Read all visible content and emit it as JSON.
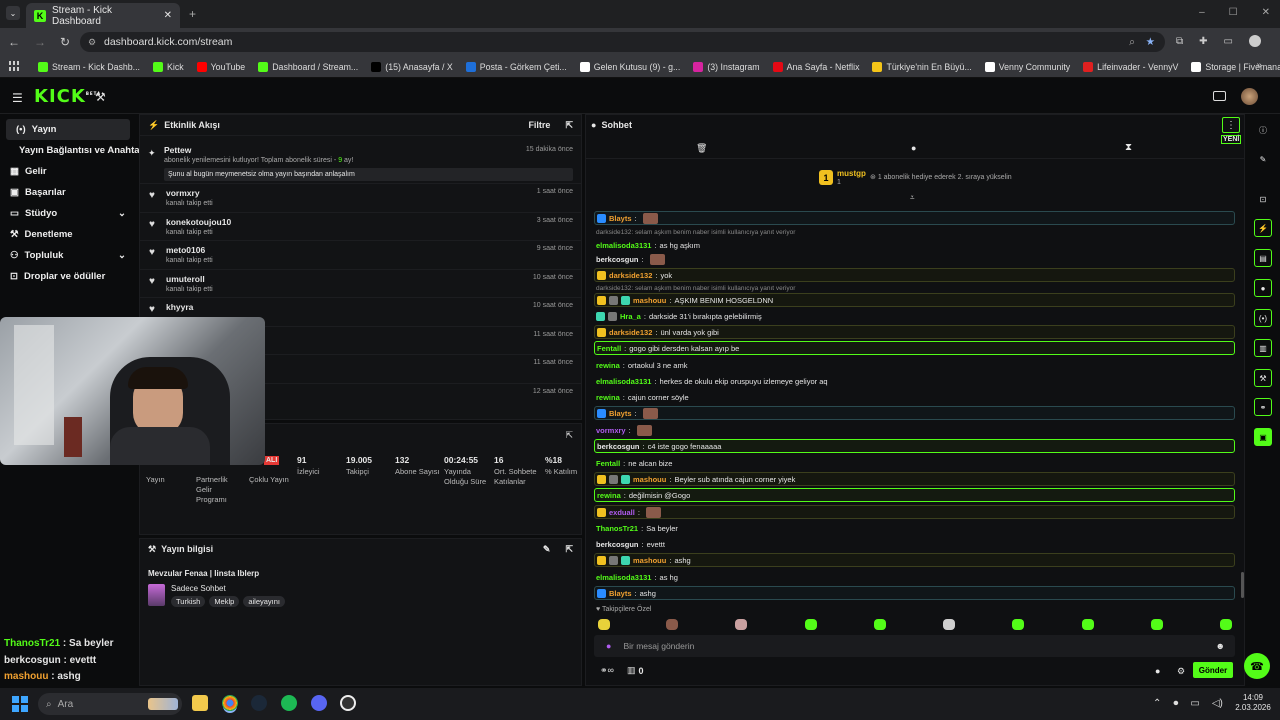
{
  "browser": {
    "tab_title": "Stream - Kick Dashboard",
    "url": "dashboard.kick.com/stream",
    "bookmarks": [
      {
        "label": "Stream - Kick Dashb...",
        "color": "#53fc18"
      },
      {
        "label": "Kick",
        "color": "#53fc18"
      },
      {
        "label": "YouTube",
        "color": "#ff0000"
      },
      {
        "label": "Dashboard / Stream...",
        "color": "#53fc18"
      },
      {
        "label": "(15) Anasayfa / X",
        "color": "#000000"
      },
      {
        "label": "Posta - Görkem Çeti...",
        "color": "#1e6fd9"
      },
      {
        "label": "Gelen Kutusu (9) - g...",
        "color": "#ffffff"
      },
      {
        "label": "(3) Instagram",
        "color": "#d6249f"
      },
      {
        "label": "Ana Sayfa - Netflix",
        "color": "#e50914"
      },
      {
        "label": "Türkiye'nin En Büyü...",
        "color": "#f5c518"
      },
      {
        "label": "Venny Community",
        "color": "#ffffff"
      },
      {
        "label": "Lifeinvader - VennyV",
        "color": "#e02020"
      },
      {
        "label": "Storage | Fivemanage",
        "color": "#ffffff"
      }
    ]
  },
  "kick": {
    "logo": "KICK",
    "beta": "BETA"
  },
  "sidebar": {
    "items": [
      {
        "label": "Yayın",
        "icon": "broadcast-icon"
      },
      {
        "label": "Yayın Bağlantısı ve Anahtarı",
        "icon": ""
      },
      {
        "label": "Gelir",
        "icon": "revenue-icon"
      },
      {
        "label": "Başarılar",
        "icon": "achievements-icon"
      },
      {
        "label": "Stüdyo",
        "icon": "studio-icon"
      },
      {
        "label": "Denetleme",
        "icon": "moderation-icon"
      },
      {
        "label": "Topluluk",
        "icon": "community-icon"
      },
      {
        "label": "Droplar ve ödüller",
        "icon": "drops-icon"
      }
    ]
  },
  "activity": {
    "title": "Etkinlik Akışı",
    "filter": "Filtre",
    "top": {
      "name": "Pettew",
      "time": "15 dakika önce",
      "sub_before": "abonelik yenilemesini kutluyor! Toplam abonelik süresi - ",
      "months": "9",
      "sub_after": " ay!",
      "message": "Şunu al bugün meymenetsiz olma yayın başından anlaşalım"
    },
    "items": [
      {
        "name": "vormxry",
        "sub": "kanalı takip etti",
        "time": "1 saat önce"
      },
      {
        "name": "konekotoujou10",
        "sub": "kanalı takip etti",
        "time": "3 saat önce"
      },
      {
        "name": "meto0106",
        "sub": "kanalı takip etti",
        "time": "9 saat önce"
      },
      {
        "name": "umuteroll",
        "sub": "kanalı takip etti",
        "time": "10 saat önce"
      },
      {
        "name": "khyyra",
        "sub": "",
        "time": "10 saat önce"
      },
      {
        "name": "",
        "sub": "",
        "time": "11 saat önce"
      },
      {
        "name": "",
        "sub": "",
        "time": "11 saat önce"
      },
      {
        "name": "",
        "sub": "",
        "time": "12 saat önce"
      }
    ]
  },
  "stats": {
    "live_badge": "ALI",
    "items": [
      {
        "value": "",
        "label": "Yayın"
      },
      {
        "value": "",
        "label": "Partnerlik Gelir Programı"
      },
      {
        "value": "",
        "label": "Çoklu Yayın"
      },
      {
        "value": "91",
        "label": "İzleyici"
      },
      {
        "value": "19.005",
        "label": "Takipçi"
      },
      {
        "value": "132",
        "label": "Abone Sayısı"
      },
      {
        "value": "00:24:55",
        "label": "Yayında Olduğu Süre"
      },
      {
        "value": "16",
        "label": "Ort. Sohbete Katılanlar"
      },
      {
        "value": "%18",
        "label": "% Katılım"
      }
    ]
  },
  "stream_info": {
    "title": "Yayın bilgisi",
    "stream_title": "Mevzular Fenaa | Iinsta Iblerp",
    "category": "Sadece Sohbet",
    "tags": [
      "Turkish",
      "Meklp",
      "aileyayını"
    ]
  },
  "chat": {
    "title": "Sohbet",
    "new_label": "YENİ",
    "pinned_user": "mustgp",
    "pinned_count": "1",
    "pinned_text": "1 abonelik hediye ederek 2. sıraya yükselin",
    "messages": [
      {
        "user": "Blayts",
        "color": "#f0a030",
        "text": "",
        "emote": true,
        "style": "bbox",
        "badges": [
          "#2a8cff"
        ]
      },
      {
        "reply": "darkside132: selam aşkım benim naber isimli kullanıcıya yanıt veriyor"
      },
      {
        "user": "elmalisoda3131",
        "color": "#53fc18",
        "text": "as hg aşkım",
        "style": "",
        "badges": []
      },
      {
        "user": "berkcosgun",
        "color": "#e6e6e6",
        "text": "",
        "emote": true,
        "style": "",
        "badges": []
      },
      {
        "user": "darkside132",
        "color": "#f0a030",
        "text": "yok",
        "style": "box",
        "badges": [
          "#f0c020"
        ]
      },
      {
        "reply": "darkside132: selam aşkım benim naber isimli kullanıcıya yanıt veriyor"
      },
      {
        "user": "mashouu",
        "color": "#f0a030",
        "text": "AŞKIM BENIM HOSGELDNN",
        "style": "box",
        "badges": [
          "#f0c020",
          "#777",
          "#3dd6b0"
        ]
      },
      {
        "user": "Hra_a",
        "color": "#53fc18",
        "text": "darkside 31'i bırakıpta gelebilirmiş",
        "style": "",
        "badges": [
          "#3dd6b0",
          "#777"
        ]
      },
      {
        "user": "darkside132",
        "color": "#f0a030",
        "text": "ünl varda yok gibi",
        "style": "box",
        "badges": [
          "#f0c020"
        ]
      },
      {
        "user": "Fentall",
        "color": "#53fc18",
        "text": "gogo gibi dersden kalsan ayıp be",
        "style": "gbox",
        "badges": []
      },
      {
        "user": "rewina",
        "color": "#53fc18",
        "text": "ortaokul 3 ne amk",
        "style": "",
        "badges": []
      },
      {
        "user": "elmalisoda3131",
        "color": "#53fc18",
        "text": "herkes de okulu ekip oruspuyu izlemeye geliyor aq",
        "style": "",
        "badges": []
      },
      {
        "user": "rewina",
        "color": "#53fc18",
        "text": "cajun corner söyle",
        "style": "",
        "badges": []
      },
      {
        "user": "Blayts",
        "color": "#f0a030",
        "text": "",
        "emote": true,
        "style": "bbox",
        "badges": [
          "#2a8cff"
        ]
      },
      {
        "user": "vormxry",
        "color": "#b05cf0",
        "text": "",
        "emote": true,
        "style": "",
        "badges": []
      },
      {
        "user": "berkcosgun",
        "color": "#e6e6e6",
        "text": "c4 iste gogo fenaaaaa",
        "style": "gbox",
        "badges": []
      },
      {
        "user": "Fentall",
        "color": "#53fc18",
        "text": "ne alcan bize",
        "style": "",
        "badges": []
      },
      {
        "user": "mashouu",
        "color": "#f0a030",
        "text": "Beyler sub atında cajun corner yiyek",
        "style": "box",
        "badges": [
          "#f0c020",
          "#777",
          "#3dd6b0"
        ]
      },
      {
        "user": "rewina",
        "color": "#53fc18",
        "text": "değilmisin @Gogo",
        "style": "gbox",
        "badges": []
      },
      {
        "user": "exduall",
        "color": "#b05cf0",
        "text": "",
        "emote": true,
        "style": "box",
        "badges": [
          "#f0c020"
        ]
      },
      {
        "user": "ThanosTr21",
        "color": "#53fc18",
        "text": "Sa beyler",
        "style": "",
        "badges": []
      },
      {
        "user": "berkcosgun",
        "color": "#e6e6e6",
        "text": "evettt",
        "style": "",
        "badges": []
      },
      {
        "user": "mashouu",
        "color": "#f0a030",
        "text": "ashg",
        "style": "box",
        "badges": [
          "#f0c020",
          "#777",
          "#3dd6b0"
        ]
      },
      {
        "user": "elmalisoda3131",
        "color": "#53fc18",
        "text": "as hg",
        "style": "",
        "badges": []
      },
      {
        "user": "Blayts",
        "color": "#f0a030",
        "text": "ashg",
        "style": "bbox",
        "badges": [
          "#2a8cff"
        ]
      }
    ],
    "follower_only": "Takipçilere Özel",
    "input_placeholder": "Bir mesaj gönderin",
    "points": "0",
    "send": "Gönder"
  },
  "overlay_chat": [
    {
      "user": "ThanosTr21",
      "color": "#53fc18",
      "text": " : Sa beyler"
    },
    {
      "user": "berkcosgun",
      "color": "#e6e6e6",
      "text": " : evettt"
    },
    {
      "user": "mashouu",
      "color": "#f0a030",
      "text": " : ashg"
    },
    {
      "user": "elmalisoda3131",
      "color": "#53fc18",
      "text": " : as hg"
    },
    {
      "user": "Blayts",
      "color": "#f0a030",
      "text": " : ashg"
    }
  ],
  "taskbar": {
    "search": "Ara",
    "time": "14:09",
    "date": "2.03.2026"
  }
}
